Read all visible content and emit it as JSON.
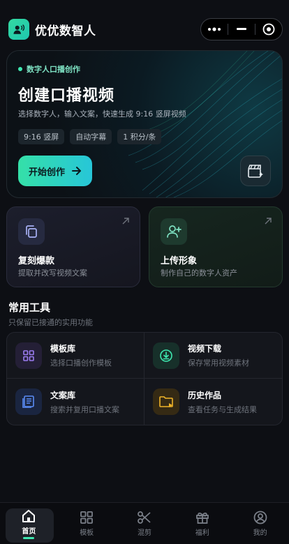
{
  "header": {
    "app_title": "优优数智人",
    "logo_icon": "speaking-person-icon",
    "capsule": {
      "more_icon": "more-dots-icon",
      "minimize_icon": "minimize-icon",
      "close_icon": "target-circle-icon"
    }
  },
  "hero": {
    "tag": "数字人口播创作",
    "title": "创建口播视频",
    "subtitle": "选择数字人，输入文案，快速生成 9:16 竖屏视频",
    "chips": [
      "9:16 竖屏",
      "自动字幕",
      "1 积分/条"
    ],
    "start_label": "开始创作",
    "side_button_icon": "clapperboard-sparkle-icon"
  },
  "features": [
    {
      "title": "复刻爆款",
      "subtitle": "提取并改写视频文案",
      "icon": "copy-icon"
    },
    {
      "title": "上传形象",
      "subtitle": "制作自己的数字人资产",
      "icon": "add-person-icon"
    }
  ],
  "tools": {
    "title": "常用工具",
    "subtitle": "只保留已接通的实用功能",
    "items": [
      {
        "title": "模板库",
        "subtitle": "选择口播创作模板",
        "icon": "grid-icon",
        "color": "#9b7cf0"
      },
      {
        "title": "视频下载",
        "subtitle": "保存常用视频素材",
        "icon": "download-circle-icon",
        "color": "#3ee8b0"
      },
      {
        "title": "文案库",
        "subtitle": "搜索并复用口播文案",
        "icon": "document-list-icon",
        "color": "#5a8cf5"
      },
      {
        "title": "历史作品",
        "subtitle": "查看任务与生成结果",
        "icon": "folder-play-icon",
        "color": "#f0b429"
      }
    ]
  },
  "nav": {
    "items": [
      {
        "label": "首页",
        "icon": "home-icon",
        "active": true
      },
      {
        "label": "模板",
        "icon": "grid-icon",
        "active": false
      },
      {
        "label": "混剪",
        "icon": "scissors-icon",
        "active": false
      },
      {
        "label": "福利",
        "icon": "gift-icon",
        "active": false
      },
      {
        "label": "我的",
        "icon": "user-circle-icon",
        "active": false
      }
    ]
  },
  "colors": {
    "accent": "#3ee8b0",
    "accent_end": "#27c6d8",
    "background": "#0d0f14"
  }
}
